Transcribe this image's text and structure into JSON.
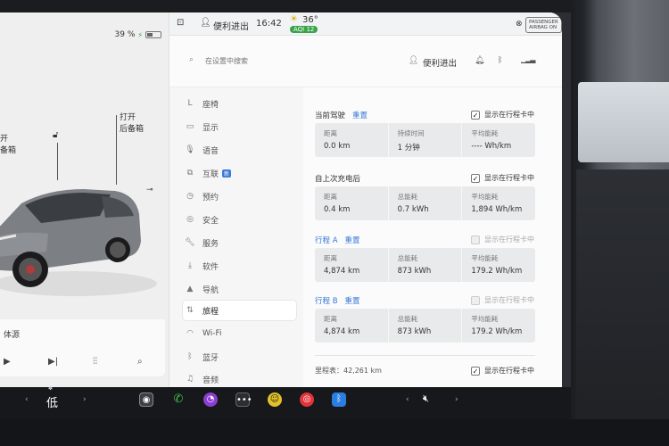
{
  "car": {
    "battery_percent": "39 %",
    "open_label_left_1": "开",
    "open_label_left_2": "备箱",
    "open_trunk_1": "打开",
    "open_trunk_2": "后备箱"
  },
  "media": {
    "source": "体源"
  },
  "status_bar": {
    "profile_name": "便利进出",
    "time": "16:42",
    "temperature": "36°",
    "aqi": "AQI 12",
    "passenger_airbag_1": "PASSENGER",
    "passenger_airbag_2": "AIRBAG ON"
  },
  "header": {
    "search_placeholder": "在设置中搜索",
    "profile_name": "便利进出"
  },
  "nav": {
    "items": [
      {
        "label": "座椅",
        "icon": "seat-icon"
      },
      {
        "label": "显示",
        "icon": "display-icon"
      },
      {
        "label": "语音",
        "icon": "microphone-icon"
      },
      {
        "label": "互联",
        "icon": "connectivity-icon",
        "badge": "新"
      },
      {
        "label": "预约",
        "icon": "schedule-icon"
      },
      {
        "label": "安全",
        "icon": "safety-icon"
      },
      {
        "label": "服务",
        "icon": "wrench-icon"
      },
      {
        "label": "软件",
        "icon": "download-icon"
      },
      {
        "label": "导航",
        "icon": "navigation-icon"
      },
      {
        "label": "旅程",
        "icon": "trips-icon"
      },
      {
        "label": "Wi-Fi",
        "icon": "wifi-icon"
      },
      {
        "label": "蓝牙",
        "icon": "bluetooth-icon"
      },
      {
        "label": "音频",
        "icon": "audio-icon"
      }
    ],
    "active": "旅程"
  },
  "trips": {
    "show_on_card": "显示在行程卡中",
    "current_drive": {
      "title": "当前驾驶",
      "reset": "重置",
      "stats": [
        {
          "label": "距离",
          "value": "0.0 km"
        },
        {
          "label": "持续时间",
          "value": "1 分钟"
        },
        {
          "label": "平均能耗",
          "value": "---- Wh/km"
        }
      ]
    },
    "since_last_charge": {
      "title": "自上次充电后",
      "stats": [
        {
          "label": "距离",
          "value": "0.4 km"
        },
        {
          "label": "总能耗",
          "value": "0.7 kWh"
        },
        {
          "label": "平均能耗",
          "value": "1,894 Wh/km"
        }
      ]
    },
    "trip_a": {
      "title": "行程 A",
      "reset": "重置",
      "stats": [
        {
          "label": "距离",
          "value": "4,874 km"
        },
        {
          "label": "总能耗",
          "value": "873 kWh"
        },
        {
          "label": "平均能耗",
          "value": "179.2 Wh/km"
        }
      ]
    },
    "trip_b": {
      "title": "行程 B",
      "reset": "重置",
      "stats": [
        {
          "label": "距离",
          "value": "4,874 km"
        },
        {
          "label": "总能耗",
          "value": "873 kWh"
        },
        {
          "label": "平均能耗",
          "value": "179.2 Wh/km"
        }
      ]
    },
    "odometer": "里程表：42,261 km"
  },
  "taskbar": {
    "fan_level": "低"
  },
  "colors": {
    "accent_blue": "#3a78d8",
    "aqi_green": "#3aa24a"
  }
}
